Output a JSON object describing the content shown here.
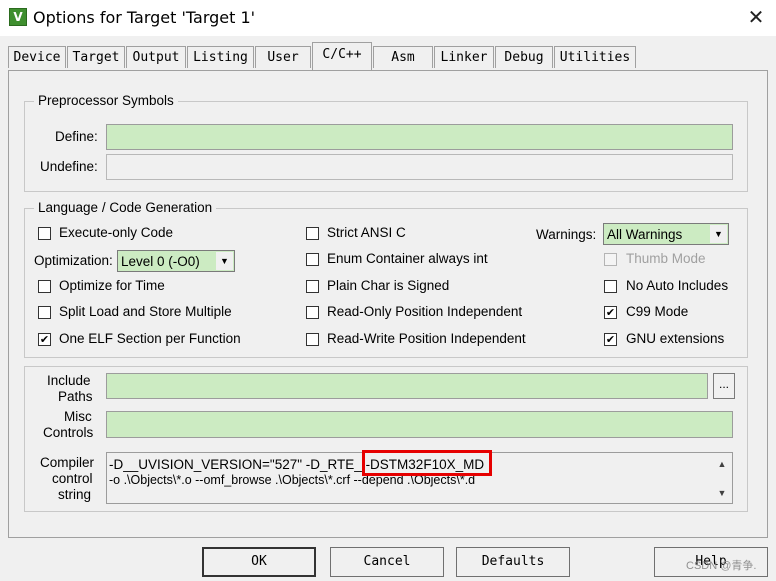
{
  "window": {
    "title": "Options for Target 'Target 1'",
    "app_icon_glyph": "V",
    "close_glyph": "✕"
  },
  "tabs": [
    {
      "label": "Device"
    },
    {
      "label": "Target"
    },
    {
      "label": "Output"
    },
    {
      "label": "Listing"
    },
    {
      "label": "User"
    },
    {
      "label": "C/C++"
    },
    {
      "label": "Asm"
    },
    {
      "label": "Linker"
    },
    {
      "label": "Debug"
    },
    {
      "label": "Utilities"
    }
  ],
  "active_tab": "C/C++",
  "preprocessor": {
    "group_label": "Preprocessor Symbols",
    "define_label": "Define:",
    "define_value": "",
    "undefine_label": "Undefine:",
    "undefine_value": ""
  },
  "language": {
    "group_label": "Language / Code Generation",
    "execute_only": {
      "label": "Execute-only Code",
      "checked": false
    },
    "optimization_label": "Optimization:",
    "optimization_value": "Level 0 (-O0)",
    "optimize_time": {
      "label": "Optimize for Time",
      "checked": false
    },
    "split_load": {
      "label": "Split Load and Store Multiple",
      "checked": false
    },
    "one_elf": {
      "label": "One ELF Section per Function",
      "checked": true,
      "mark": "✔"
    },
    "strict_ansi": {
      "label": "Strict ANSI C",
      "checked": false
    },
    "enum_container": {
      "label": "Enum Container always int",
      "checked": false
    },
    "plain_char": {
      "label": "Plain Char is Signed",
      "checked": false
    },
    "ro_pos_indep": {
      "label": "Read-Only Position Independent",
      "checked": false
    },
    "rw_pos_indep": {
      "label": "Read-Write Position Independent",
      "checked": false
    },
    "warnings_label": "Warnings:",
    "warnings_value": "All Warnings",
    "thumb_mode": {
      "label": "Thumb Mode",
      "checked": false,
      "disabled": true
    },
    "no_auto_includes": {
      "label": "No Auto Includes",
      "checked": false
    },
    "c99_mode": {
      "label": "C99 Mode",
      "checked": true,
      "mark": "✔"
    },
    "gnu_extensions": {
      "label": "GNU extensions",
      "checked": true,
      "mark": "✔"
    }
  },
  "paths": {
    "include_label_1": "Include",
    "include_label_2": "Paths",
    "include_value": "",
    "browse_label": "...",
    "misc_label_1": "Misc",
    "misc_label_2": "Controls",
    "misc_value": ""
  },
  "compiler": {
    "label_1": "Compiler",
    "label_2": "control",
    "label_3": "string",
    "line1_prefix": "-D__UVISION_VERSION=\"527\" -D_RTE_ ",
    "line1_highlight": "-DSTM32F10X_MD",
    "line2": "-o .\\Objects\\*.o --omf_browse .\\Objects\\*.crf --depend .\\Objects\\*.d",
    "highlight_color": "#e60000"
  },
  "buttons": {
    "ok": "OK",
    "cancel": "Cancel",
    "defaults": "Defaults",
    "help": "Help"
  },
  "watermark": "CSDN @青争."
}
